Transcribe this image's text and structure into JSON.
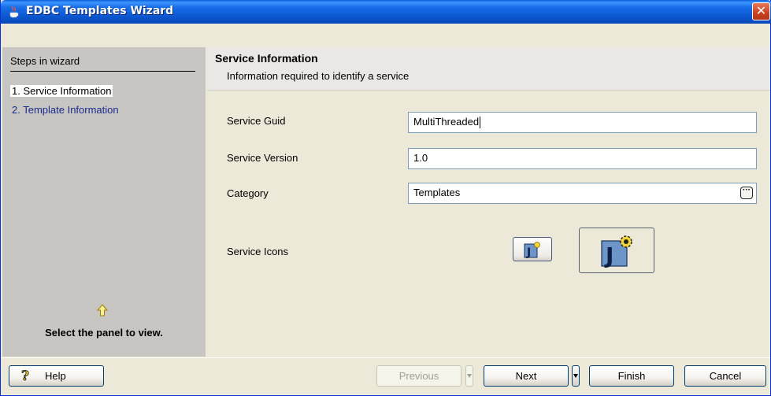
{
  "window": {
    "title": "EDBC Templates Wizard",
    "close_glyph": "✕"
  },
  "steps": {
    "header": "Steps in wizard",
    "items": [
      {
        "label": "1. Service Information",
        "active": true
      },
      {
        "label": "2. Template Information",
        "active": false
      }
    ],
    "hint": "Select the panel to view."
  },
  "content": {
    "title": "Service Information",
    "subtitle": "Information required to identify a service"
  },
  "form": {
    "service_guid": {
      "label": "Service Guid",
      "value": "MultiThreaded"
    },
    "service_version": {
      "label": "Service Version",
      "value": "1.0"
    },
    "category": {
      "label": "Category",
      "value": "Templates",
      "button_glyph": "···"
    },
    "service_icons": {
      "label": "Service Icons"
    }
  },
  "buttons": {
    "help": "Help",
    "previous": "Previous",
    "next": "Next",
    "finish": "Finish",
    "cancel": "Cancel"
  },
  "colors": {
    "title_bar": "#0b57d0",
    "steps_panel": "#c7c6c2",
    "inactive_step": "#1a2a8c",
    "window_bg": "#ece9d8"
  }
}
